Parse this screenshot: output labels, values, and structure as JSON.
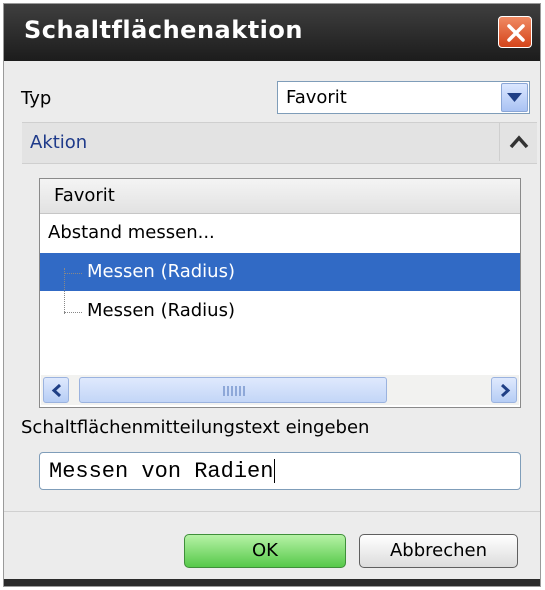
{
  "dialog": {
    "title": "Schaltflächenaktion",
    "close_icon": "close-icon"
  },
  "type_field": {
    "label": "Typ",
    "value": "Favorit"
  },
  "action_section": {
    "title": "Aktion",
    "collapse_icon": "chevron-up-icon"
  },
  "tree": {
    "header": "Favorit",
    "rows": [
      {
        "label": "Abstand messen...",
        "selected": false
      },
      {
        "label": "Messen (Radius)",
        "selected": true
      },
      {
        "label": "Messen (Radius)",
        "selected": false
      }
    ],
    "scrollbar": {
      "left_icon": "scroll-left-icon",
      "right_icon": "scroll-right-icon"
    }
  },
  "message": {
    "label": "Schaltflächenmitteilungstext eingeben",
    "value": "Messen von Radien"
  },
  "buttons": {
    "ok": "OK",
    "cancel": "Abbrechen"
  },
  "colors": {
    "selection": "#316ac5",
    "ok_button": "#56c94a",
    "close_button": "#d4441a",
    "titlebar": "#2a2a2a"
  }
}
